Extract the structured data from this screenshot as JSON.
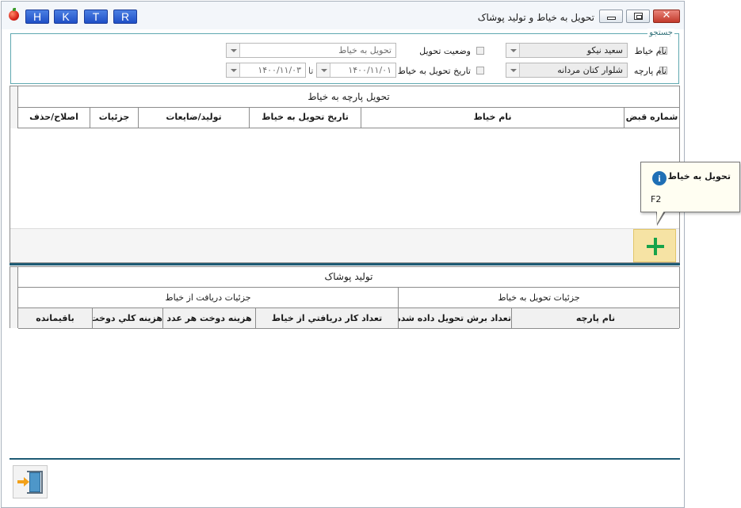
{
  "window": {
    "title": "تحویل به خیاط و تولید پوشاک",
    "hotkeys": [
      "H",
      "K",
      "T",
      "R"
    ],
    "close_glyph": "✕"
  },
  "search": {
    "legend": "جستجو",
    "tailor_name_label": "نام خیاط",
    "tailor_name_value": "سعید نیکو",
    "fabric_name_label": "نام پارچه",
    "fabric_name_value": "شلوار کتان مردانه",
    "delivery_status_label": "وضعیت تحویل",
    "delivery_status_value": "تحویل به خیاط",
    "delivery_date_label": "تاریخ تحویل به خیاط",
    "date_from": "۱۴۰۰/۱۱/۰۱",
    "date_to_label": "تا",
    "date_to": "۱۴۰۰/۱۱/۰۳"
  },
  "grid_delivery": {
    "title": "تحویل پارچه به خیاط",
    "columns": [
      "شماره قبض",
      "نام خیاط",
      "تاریخ تحویل به خیاط",
      "تولید/ضایعات",
      "جزئیات",
      "اصلاح/حذف"
    ]
  },
  "tooltip": {
    "title": "تحویل به خیاط",
    "shortcut": "F2",
    "icon": "info-icon"
  },
  "grid_production": {
    "title": "تولید پوشاک",
    "group_delivery": "جزئیات تحویل به خیاط",
    "group_receive": "جزئیات دریافت از خیاط",
    "columns": [
      "نام پارچه",
      "تعداد برش تحویل داده شده",
      "تعداد کار دریافتي از خیاط",
      "هزینه دوخت هر عدد",
      "هزينه کلي دوخت",
      "باقیمانده"
    ]
  },
  "colors": {
    "accent_line": "#1e5b74",
    "add_button_bg": "#f6e3a4",
    "plus_icon": "#17a34a",
    "hotkey_blue": "#1f4fc6",
    "close_red": "#c23a2b"
  },
  "icons": [
    "app-icon",
    "plus-icon",
    "exit-door-icon",
    "info-icon",
    "minimize-icon",
    "maximize-icon",
    "close-icon"
  ]
}
